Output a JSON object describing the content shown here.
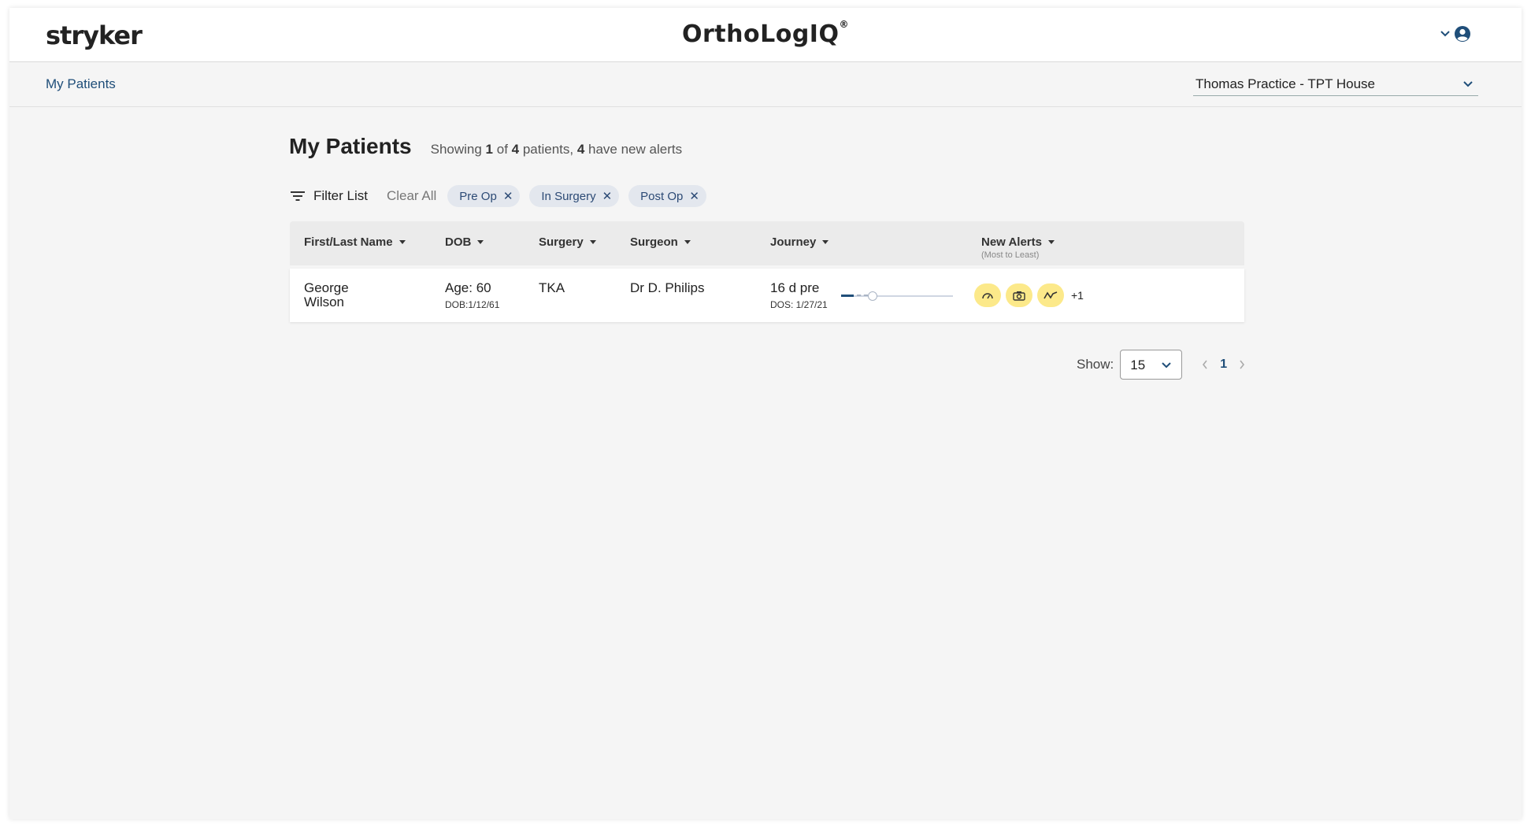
{
  "header": {
    "brand": "stryker",
    "app_title": "OrthoLogIQ",
    "registered_mark": "®",
    "user_icon": "user-circle-icon",
    "menu_icon": "chevron-down-icon"
  },
  "subnav": {
    "breadcrumb": "My Patients",
    "practice_selected": "Thomas Practice - TPT House"
  },
  "page": {
    "title": "My Patients",
    "summary": {
      "prefix": "Showing ",
      "shown": "1",
      "of": " of ",
      "total": "4",
      "middle": " patients, ",
      "alerts_count": "4",
      "suffix": " have new alerts"
    }
  },
  "filters": {
    "filter_label": "Filter List",
    "clear_label": "Clear All",
    "chips": [
      {
        "label": "Pre Op"
      },
      {
        "label": "In Surgery"
      },
      {
        "label": "Post Op"
      }
    ]
  },
  "table": {
    "columns": {
      "name": "First/Last Name",
      "dob": "DOB",
      "surgery": "Surgery",
      "surgeon": "Surgeon",
      "journey": "Journey",
      "alerts": "New Alerts",
      "alerts_sub": "(Most to Least)"
    },
    "rows": [
      {
        "first": "George",
        "last": "Wilson",
        "age": "Age: 60",
        "dob": "DOB:1/12/61",
        "surgery": "TKA",
        "surgeon": "Dr D. Philips",
        "journey": "16 d pre",
        "dos": "DOS: 1/27/21",
        "alert_icons": [
          "gauge-icon",
          "camera-icon",
          "activity-icon"
        ],
        "more_alerts": "+1"
      }
    ]
  },
  "pagination": {
    "show_label": "Show:",
    "page_size": "15",
    "current_page": "1"
  },
  "colors": {
    "accent": "#1f4e79",
    "chip_bg": "#e3e7ee",
    "alert_bg": "#fce98a"
  }
}
